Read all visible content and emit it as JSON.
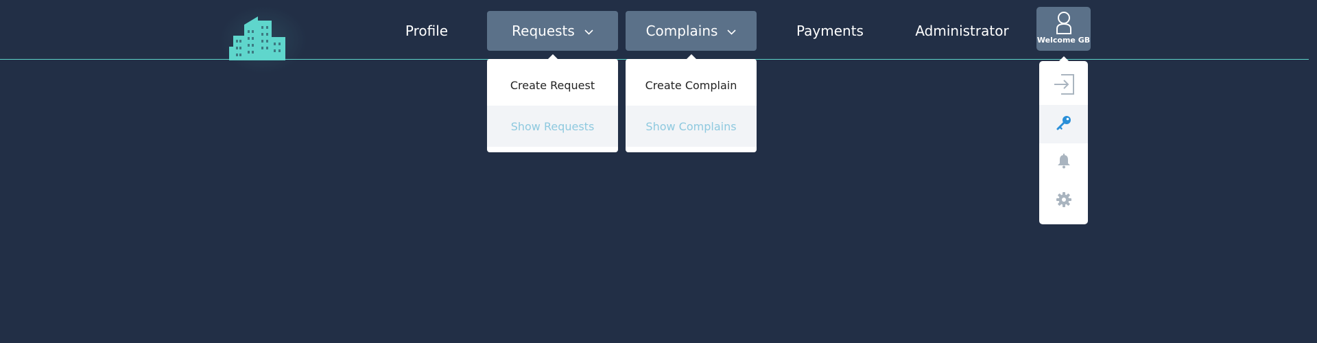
{
  "colors": {
    "background": "#222f46",
    "accent": "#5fd6cc",
    "active_nav": "#5b7189",
    "dropdown_hover_text": "#8ec9df",
    "key_icon": "#2a8fd8",
    "muted_icon": "#a9b4bf"
  },
  "logo": {
    "icon": "building-logo-icon"
  },
  "nav": {
    "profile": "Profile",
    "requests": "Requests",
    "complains": "Complains",
    "payments": "Payments",
    "administrator": "Administrator"
  },
  "requests_menu": {
    "create": "Create Request",
    "show": "Show Requests"
  },
  "complains_menu": {
    "create": "Create Complain",
    "show": "Show Complains"
  },
  "user": {
    "welcome": "Welcome GB",
    "icon": "user-icon",
    "menu_icons": [
      "logout-icon",
      "key-icon",
      "bell-icon",
      "gear-icon"
    ]
  }
}
